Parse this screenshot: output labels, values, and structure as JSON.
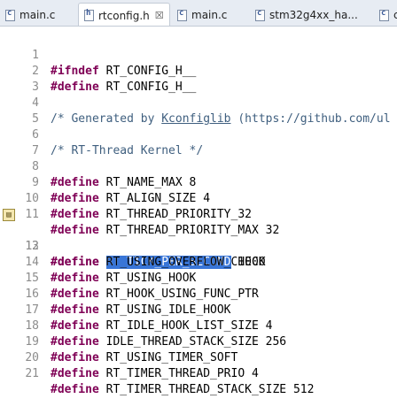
{
  "tabs": [
    {
      "label": "main.c",
      "icon": "c-file-icon",
      "active": false
    },
    {
      "label": "rtconfig.h",
      "icon": "h-file-icon",
      "active": true,
      "close": "☒"
    },
    {
      "label": "main.c",
      "icon": "c-file-icon",
      "active": false
    },
    {
      "label": "stm32g4xx_ha...",
      "icon": "c-file-icon",
      "active": false
    },
    {
      "label": "c",
      "icon": "c-file-icon",
      "active": false
    }
  ],
  "editor": {
    "lines": [
      {
        "n": "1",
        "kw": "#ifndef",
        "text": " RT_CONFIG_H__"
      },
      {
        "n": "2",
        "kw": "#define",
        "text": " RT_CONFIG_H__"
      },
      {
        "n": "3"
      },
      {
        "n": "4",
        "comment_pre": "/* Generated by ",
        "link": "Kconfiglib",
        "comment_post": " (https://github.com/ul"
      },
      {
        "n": "5"
      },
      {
        "n": "6",
        "comment": "/* RT-Thread Kernel */"
      },
      {
        "n": "7"
      },
      {
        "n": "8",
        "kw": "#define",
        "text": " RT_NAME_MAX 8"
      },
      {
        "n": "9",
        "kw": "#define",
        "text": " RT_ALIGN_SIZE 4"
      },
      {
        "n": "10",
        "kw": "#define",
        "text": " RT_THREAD_PRIORITY_32"
      },
      {
        "n": "11",
        "kw": "#define",
        "text": " RT_THREAD_PRIORITY_MAX 32"
      },
      {
        "n": "12",
        "kw": "#define",
        "pre": " ",
        "selected": "RT_TICK_PER_SECOND",
        "text": " 1000",
        "marker": true
      },
      {
        "n": "13",
        "kw": "#define",
        "text": " RT_USING_OVERFLOW_CHECK"
      },
      {
        "n": "14",
        "kw": "#define",
        "text": " RT_USING_HOOK"
      },
      {
        "n": "15",
        "kw": "#define",
        "text": " RT_HOOK_USING_FUNC_PTR"
      },
      {
        "n": "16",
        "kw": "#define",
        "text": " RT_USING_IDLE_HOOK"
      },
      {
        "n": "17",
        "kw": "#define",
        "text": " RT_IDLE_HOOK_LIST_SIZE 4"
      },
      {
        "n": "18",
        "kw": "#define",
        "text": " IDLE_THREAD_STACK_SIZE 256"
      },
      {
        "n": "19",
        "kw": "#define",
        "text": " RT_USING_TIMER_SOFT"
      },
      {
        "n": "20",
        "kw": "#define",
        "text": " RT_TIMER_THREAD_PRIO 4"
      },
      {
        "n": "21",
        "kw": "#define",
        "text": " RT_TIMER_THREAD_STACK_SIZE 512"
      }
    ]
  },
  "colors": {
    "keyword": "#7f0055",
    "comment": "#3f5f7f",
    "selection": "#3875d7"
  }
}
